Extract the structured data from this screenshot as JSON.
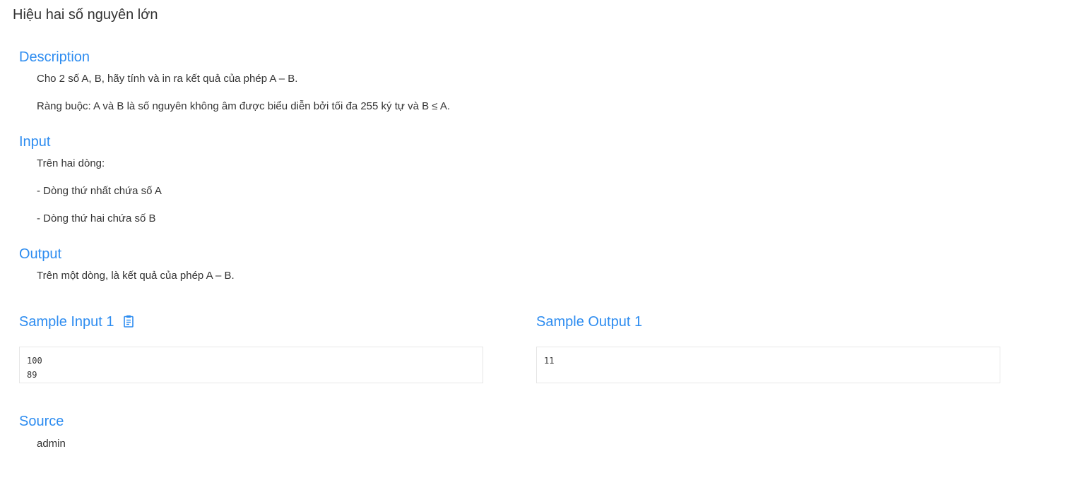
{
  "problem": {
    "title": "Hiệu hai số nguyên lớn"
  },
  "description": {
    "heading": "Description",
    "lines": [
      "Cho 2 số A, B, hãy tính và in ra kết quả của phép A – B.",
      "Ràng buộc: A và B là số nguyên không âm được biểu diễn bởi tối đa 255 ký tự và B ≤ A."
    ]
  },
  "input": {
    "heading": "Input",
    "lines": [
      "Trên hai dòng:",
      "- Dòng thứ nhất chứa số A",
      "- Dòng thứ hai chứa số B"
    ]
  },
  "output": {
    "heading": "Output",
    "lines": [
      "Trên một dòng, là kết quả của phép A – B."
    ]
  },
  "samples": {
    "input_heading": "Sample Input 1",
    "output_heading": "Sample Output 1",
    "input_value": "100\n89",
    "output_value": "11",
    "copy_icon": "clipboard-icon"
  },
  "source": {
    "heading": "Source",
    "value": "admin"
  },
  "colors": {
    "accent": "#2d8cf0",
    "text": "#333333",
    "border": "#e6e6e6"
  }
}
